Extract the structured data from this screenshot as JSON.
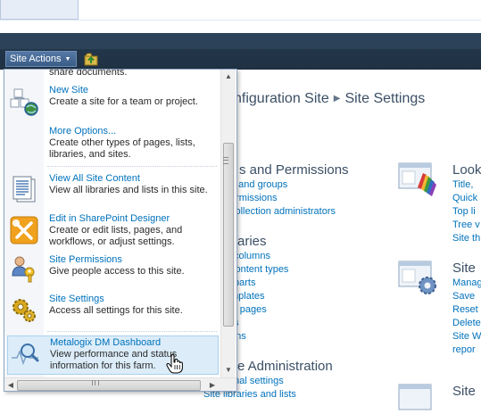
{
  "ribbon": {
    "site_actions_label": "Site Actions",
    "arrow_glyph": "▼"
  },
  "breadcrumb": {
    "part1": "nfiguration Site",
    "separator": "▶",
    "part2": "Site Settings"
  },
  "sections": {
    "users": {
      "title": "s and Permissions",
      "links": [
        "e and groups",
        "ermissions",
        "collection administrators"
      ]
    },
    "galleries": {
      "title": "aries",
      "links": [
        "columns",
        "content types",
        "parts",
        "mplates",
        "r pages",
        "s",
        "ons"
      ]
    },
    "site_admin": {
      "title": "e Administration",
      "links": [
        "onal settings",
        "Site libraries and lists"
      ]
    },
    "look": {
      "title": "Look",
      "links": [
        "Title,",
        "Quick",
        "Top li",
        "Tree v",
        "Site th"
      ]
    },
    "site_actions_sec": {
      "title": "Site",
      "links": [
        "Manag",
        "Save",
        "Reset",
        "Delete",
        "Site W",
        "repor"
      ]
    },
    "site3": {
      "title": "Site"
    }
  },
  "menu": {
    "partial_text": "share documents.",
    "items": [
      {
        "title": "New Site",
        "desc": "Create a site for a team or project.",
        "icon": "new-site-icon"
      },
      {
        "title": "More Options...",
        "desc": "Create other types of pages, lists, libraries, and sites.",
        "icon": "none"
      },
      {
        "title": "View All Site Content",
        "desc": "View all libraries and lists in this site.",
        "icon": "document-icon"
      },
      {
        "title": "Edit in SharePoint Designer",
        "desc": "Create or edit lists, pages, and workflows, or adjust settings.",
        "icon": "designer-tools-icon"
      },
      {
        "title": "Site Permissions",
        "desc": "Give people access to this site.",
        "icon": "permissions-icon"
      },
      {
        "title": "Site Settings",
        "desc": "Access all settings for this site.",
        "icon": "gear-icon"
      },
      {
        "title": "Metalogix DM Dashboard",
        "desc": "View performance and status information for this farm.",
        "icon": "dashboard-icon"
      }
    ]
  },
  "scrollbar": {
    "up": "▲",
    "down": "▼",
    "left": "◀",
    "right": "▶"
  },
  "colors": {
    "link": "#0072bc",
    "heading": "#3b4f65",
    "ribbon": "#1f3143",
    "highlight": "#dcedf9"
  }
}
